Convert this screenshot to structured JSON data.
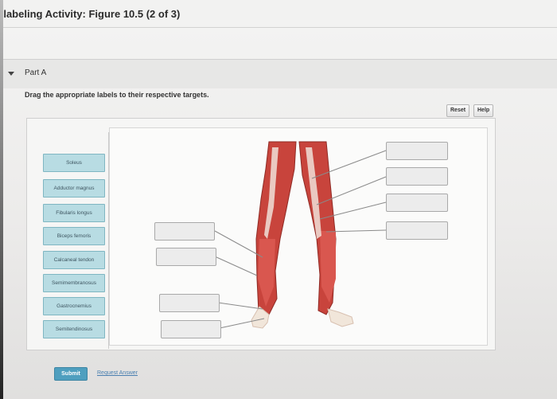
{
  "header": {
    "title": "-labeling Activity: Figure 10.5 (2 of 3)"
  },
  "part": {
    "label": "Part A",
    "instructions": "Drag the appropriate labels to their respective targets."
  },
  "toolbar": {
    "reset_label": "Reset",
    "help_label": "Help"
  },
  "labels": [
    {
      "text": "Soleus"
    },
    {
      "text": "Adductor magnus"
    },
    {
      "text": "Fibularis longus"
    },
    {
      "text": "Biceps femoris"
    },
    {
      "text": "Calcaneal tendon"
    },
    {
      "text": "Semimembranosus"
    },
    {
      "text": "Gastrocnemius"
    },
    {
      "text": "Semitendinosus"
    }
  ],
  "actions": {
    "submit_label": "Submit",
    "request_label": "Request Answer"
  },
  "colors": {
    "chip_fill": "#b8dce3",
    "submit_fill": "#4f9fbf",
    "muscle": "#c8443c",
    "tendon": "#f1e6da"
  }
}
